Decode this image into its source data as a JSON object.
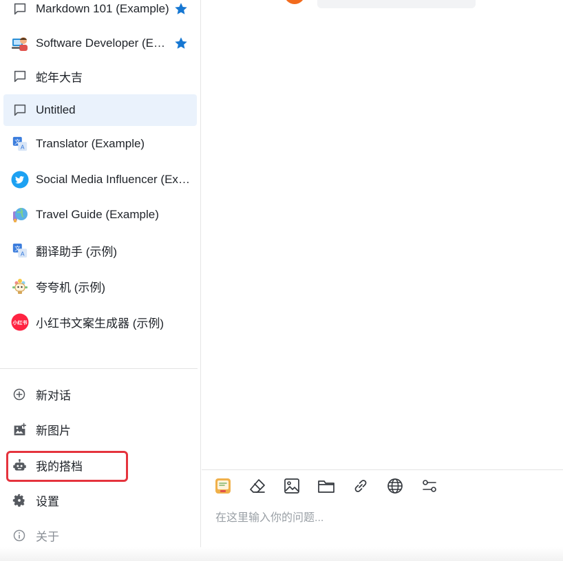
{
  "sidebar": {
    "chats": [
      {
        "label": "Markdown 101 (Example)",
        "icon": "chat-bubble-icon",
        "starred": true
      },
      {
        "label": "Software Developer (Example)",
        "icon": "developer-avatar-icon",
        "starred": true
      },
      {
        "label": "蛇年大吉",
        "icon": "chat-bubble-icon",
        "starred": false
      },
      {
        "label": "Untitled",
        "icon": "chat-bubble-icon",
        "starred": false,
        "selected": true
      },
      {
        "label": "Translator (Example)",
        "icon": "translator-icon",
        "starred": false
      },
      {
        "label": "Social Media Influencer (Example)",
        "icon": "twitter-bird-icon",
        "starred": false
      },
      {
        "label": "Travel Guide (Example)",
        "icon": "globe-travel-icon",
        "starred": false
      },
      {
        "label": "翻译助手 (示例)",
        "icon": "translator-icon",
        "starred": false
      },
      {
        "label": "夸夸机 (示例)",
        "icon": "flower-robot-icon",
        "starred": false
      },
      {
        "label": "小红书文案生成器 (示例)",
        "icon": "xiaohongshu-logo-icon",
        "starred": false
      }
    ],
    "menu": {
      "new_chat": "新对话",
      "new_image": "新图片",
      "my_partners": "我的搭档",
      "settings": "设置",
      "about": "关于"
    },
    "logo_text": {
      "xiaohongshu": "小红书",
      "translator": "文A"
    }
  },
  "input": {
    "placeholder": "在这里输入你的问题..."
  },
  "toolbar": {
    "tools": [
      "persona-icon",
      "eraser-icon",
      "image-icon",
      "folder-icon",
      "link-icon",
      "globe-icon",
      "settings-sliders-icon"
    ]
  },
  "colors": {
    "accent": "#1677d2",
    "selected_bg": "#eaf2fc",
    "highlight_red": "#e5333d",
    "avatar_orange": "#f26b1d"
  }
}
